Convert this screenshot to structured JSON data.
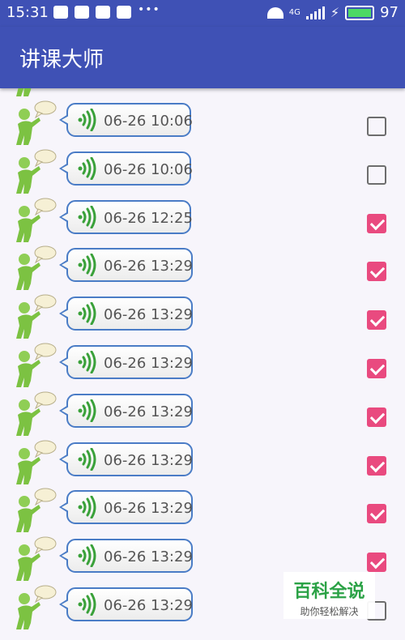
{
  "status_bar": {
    "time": "15:31",
    "network_label": "4G",
    "battery": "97"
  },
  "app_bar": {
    "title": "讲课大师"
  },
  "messages": [
    {
      "time": "06-26 10:06",
      "checked": false
    },
    {
      "time": "06-26 10:06",
      "checked": false
    },
    {
      "time": "06-26 12:25",
      "checked": true
    },
    {
      "time": "06-26 13:29",
      "checked": true
    },
    {
      "time": "06-26 13:29",
      "checked": true
    },
    {
      "time": "06-26 13:29",
      "checked": true
    },
    {
      "time": "06-26 13:29",
      "checked": true
    },
    {
      "time": "06-26 13:29",
      "checked": true
    },
    {
      "time": "06-26 13:29",
      "checked": true
    },
    {
      "time": "06-26 13:29",
      "checked": true
    },
    {
      "time": "06-26 13:29",
      "checked": false
    }
  ],
  "watermark": {
    "main": "百科全说",
    "sub": "助你轻松解决"
  },
  "colors": {
    "primary": "#3f51b5",
    "checkbox_checked": "#e94a7f",
    "voice_icon": "#3aa13a",
    "bubble_border": "#4a7cc6"
  }
}
